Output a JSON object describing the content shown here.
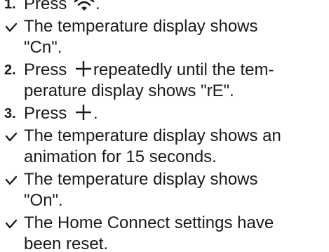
{
  "steps": [
    {
      "number": "1.",
      "before": "Press",
      "after": "."
    },
    {
      "result": "The temperature display shows",
      "result_line2": "\"Cn\"."
    },
    {
      "number": "2.",
      "before": "Press",
      "after": "repeatedly until the tem-",
      "line2": "perature display shows \"rE\"."
    },
    {
      "number": "3.",
      "before": "Press",
      "after": "."
    },
    {
      "result": "The temperature display shows an",
      "result_line2": "animation for 15 seconds."
    },
    {
      "result": "The temperature display shows",
      "result_line2": "\"On\"."
    },
    {
      "result": "The Home Connect settings have",
      "result_line2": "been reset."
    }
  ]
}
